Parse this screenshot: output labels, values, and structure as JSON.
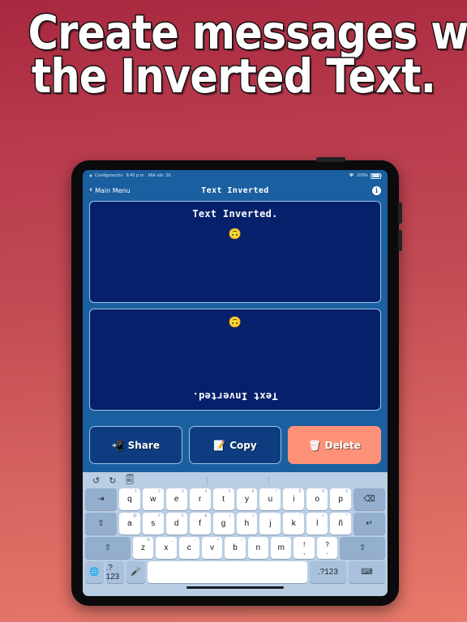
{
  "promo": {
    "line1": "Create messages with",
    "line2": "the Inverted Text.",
    "bg_top_color": "#a8283f",
    "bg_bottom_color": "#e8796b"
  },
  "device": {
    "type": "tablet",
    "frame_color": "#0b0b0d"
  },
  "statusbar": {
    "back_app": "Configuración",
    "time": "8:45 p.m.",
    "date": "Mié abr. 26",
    "wifi_icon": "wifi-icon",
    "battery_percent": "100%",
    "battery_icon": "battery-full-icon"
  },
  "navbar": {
    "back_icon": "chevron-left-icon",
    "back_label": "Main Menu",
    "title": "Text Inverted",
    "info_icon": "info-icon",
    "info_label": "i"
  },
  "app": {
    "accent_color": "#1a5fa0",
    "textbox_color": "#06206b",
    "input_box": {
      "text": "Text  Inverted.",
      "emoji": "🙃"
    },
    "output_box": {
      "text": "Text  Inverted.",
      "emoji": "🙃",
      "rotated": "180deg"
    },
    "buttons": [
      {
        "label": "Share",
        "icon": "share-icon",
        "glyph": "📲",
        "style": "primary"
      },
      {
        "label": "Copy",
        "icon": "copy-icon",
        "glyph": "📝",
        "style": "primary"
      },
      {
        "label": "Delete",
        "icon": "trash-icon",
        "glyph": "🗑",
        "style": "danger",
        "color": "#fd9278"
      }
    ]
  },
  "keyboard": {
    "layout": "Spanish",
    "toolbar": [
      {
        "name": "undo-icon",
        "glyph": "↺"
      },
      {
        "name": "redo-icon",
        "glyph": "↻"
      },
      {
        "name": "paste-icon",
        "glyph": "🗐"
      }
    ],
    "row1": {
      "tab": "⇥",
      "keys": [
        {
          "key": "q",
          "alt": "1"
        },
        {
          "key": "w",
          "alt": "2"
        },
        {
          "key": "e",
          "alt": "3"
        },
        {
          "key": "r",
          "alt": "4"
        },
        {
          "key": "t",
          "alt": "5"
        },
        {
          "key": "y",
          "alt": "6"
        },
        {
          "key": "u",
          "alt": "7"
        },
        {
          "key": "i",
          "alt": "8"
        },
        {
          "key": "o",
          "alt": "9"
        },
        {
          "key": "p",
          "alt": "0"
        }
      ],
      "backspace": "⌫"
    },
    "row2": {
      "caps": "⇪",
      "keys": [
        {
          "key": "a",
          "alt": "@"
        },
        {
          "key": "s",
          "alt": "#"
        },
        {
          "key": "d",
          "alt": "€"
        },
        {
          "key": "f",
          "alt": "&"
        },
        {
          "key": "g",
          "alt": "("
        },
        {
          "key": "h",
          "alt": ")"
        },
        {
          "key": "j",
          "alt": "'"
        },
        {
          "key": "k",
          "alt": "\""
        },
        {
          "key": "l",
          "alt": "+"
        },
        {
          "key": "ñ",
          "alt": "*"
        }
      ],
      "return": "↵"
    },
    "row3": {
      "shift_left": "⇧",
      "keys": [
        {
          "key": "z",
          "alt": "%"
        },
        {
          "key": "x",
          "alt": "_"
        },
        {
          "key": "c",
          "alt": "-"
        },
        {
          "key": "v",
          "alt": "="
        },
        {
          "key": "b",
          "alt": "/"
        },
        {
          "key": "n",
          "alt": ":"
        },
        {
          "key": "m",
          "alt": ";"
        }
      ],
      "punc": [
        {
          "up": "!",
          "dn": ","
        },
        {
          "up": "?",
          "dn": "."
        }
      ],
      "shift_right": "⇧"
    },
    "row4": {
      "globe": "🌐",
      "numeric_left": ".?123",
      "mic": "🎤",
      "space": "",
      "numeric_right": ".?123",
      "dismiss": "⌨"
    }
  }
}
